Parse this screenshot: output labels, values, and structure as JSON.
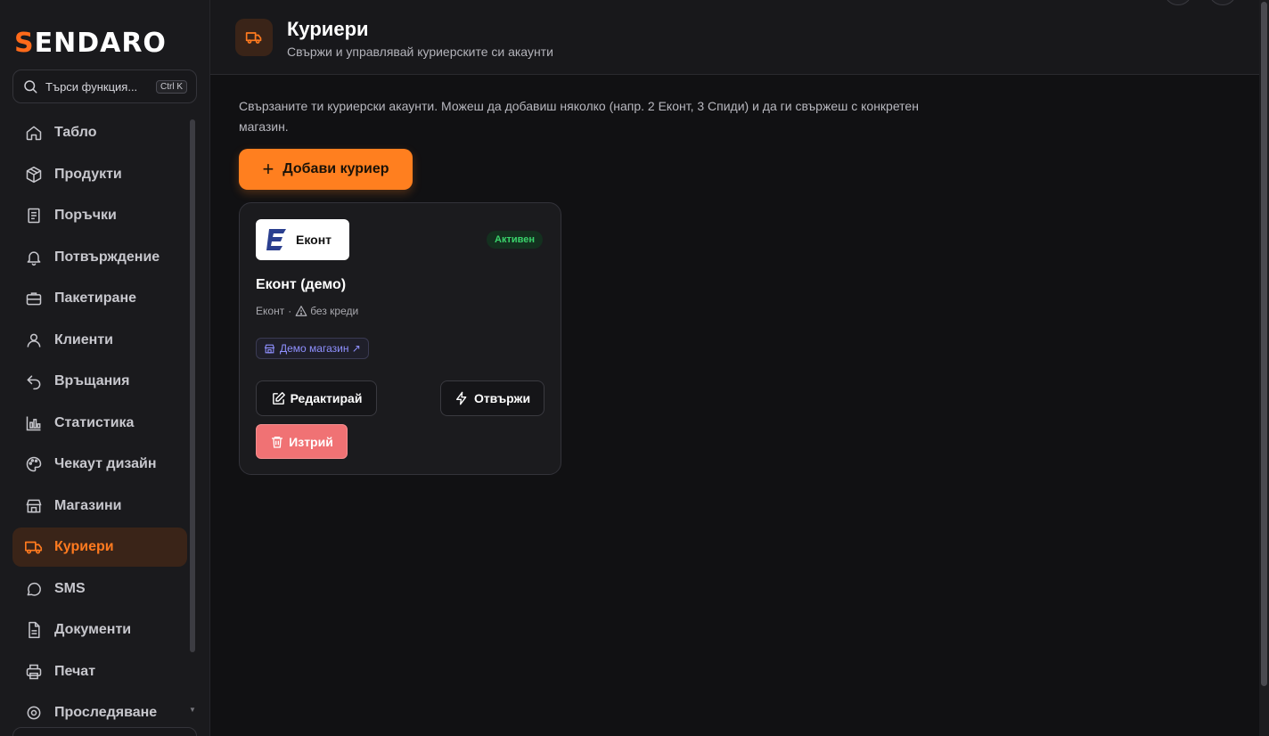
{
  "brand": {
    "logo_first": "S",
    "logo_rest": "ENDARO",
    "accent": "#ff7a1f"
  },
  "search": {
    "placeholder": "Търси функция...",
    "shortcut": "Ctrl K"
  },
  "sidebar": {
    "items": [
      {
        "label": "Табло",
        "icon": "home-icon"
      },
      {
        "label": "Продукти",
        "icon": "box-icon"
      },
      {
        "label": "Поръчки",
        "icon": "receipt-icon"
      },
      {
        "label": "Потвърждение",
        "icon": "bell-icon"
      },
      {
        "label": "Пакетиране",
        "icon": "briefcase-icon"
      },
      {
        "label": "Клиенти",
        "icon": "user-icon"
      },
      {
        "label": "Връщания",
        "icon": "undo-icon"
      },
      {
        "label": "Статистика",
        "icon": "bar-chart-icon"
      },
      {
        "label": "Чекаут дизайн",
        "icon": "palette-icon"
      },
      {
        "label": "Магазини",
        "icon": "store-icon"
      },
      {
        "label": "Куриери",
        "icon": "truck-icon",
        "active": true
      },
      {
        "label": "SMS",
        "icon": "message-icon"
      },
      {
        "label": "Документи",
        "icon": "document-icon"
      },
      {
        "label": "Печат",
        "icon": "printer-icon"
      },
      {
        "label": "Проследяване",
        "icon": "location-icon"
      }
    ]
  },
  "header": {
    "title": "Куриери",
    "subtitle": "Свържи и управлявай куриерските си акаунти",
    "icon": "truck-icon"
  },
  "main": {
    "intro": "Свързаните ти куриерски акаунти. Можеш да добавиш няколко (напр. 2 Еконт, 3 Спиди) и да ги свържеш с конкретен магазин.",
    "add_button": "Добави куриер"
  },
  "courier_card": {
    "logo_text": "Еконт",
    "status": "Активен",
    "status_color": "#3ad26b",
    "name": "Еконт (демо)",
    "carrier": "Еконт",
    "separator": "·",
    "warning": "без креди",
    "store": "Демо магазин ↗",
    "edit_button": "Редактирай",
    "unlink_button": "Отвържи",
    "delete_button": "Изтрий",
    "delete_color": "#f07274"
  }
}
